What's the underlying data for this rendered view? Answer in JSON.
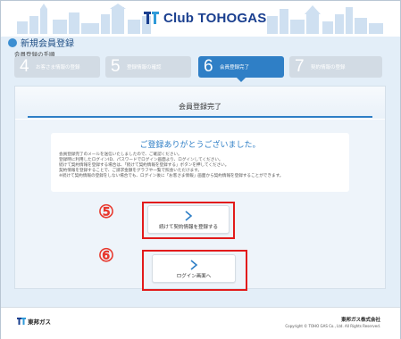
{
  "header": {
    "brand": "Club TOHOGAS"
  },
  "page": {
    "title": "新規会員登録",
    "subtitle": "会員登録の手順"
  },
  "steps": [
    {
      "num": "4",
      "label": "お客さま情報の登録",
      "active": false
    },
    {
      "num": "5",
      "label": "登録情報の確認",
      "active": false
    },
    {
      "num": "6",
      "label": "会員登録完了",
      "active": true
    },
    {
      "num": "7",
      "label": "契約情報の登録",
      "active": false
    }
  ],
  "panel": {
    "title": "会員登録完了",
    "message_title": "ご登録ありがとうございました。",
    "message_lines": [
      "会員登録完了のメールを送信いたしましたので、ご確認ください。",
      "登録時に利用したログインID、パスワードでログイン画面より、ログインしてください。",
      "続けて契約情報を登録する場合は、「続けて契約情報を登録する」ボタンを押してください。",
      "契約情報を登録することで、ご請求金額をグラフや一覧で照会いただけます。",
      "※続けて契約情報の登録をしない場合でも、ログイン後に「お客さま情報」画面から契約情報を登録することができます。"
    ]
  },
  "annotations": {
    "five": "⑤",
    "six": "⑥"
  },
  "buttons": {
    "continue_label": "続けて契約情報を登録する",
    "login_label": "ログイン画面へ"
  },
  "footer": {
    "logo_text": "東邦ガス",
    "company": "東邦ガス株式会社",
    "copyright": "Copyright © TOHO GAS Co., Ltd. All Rights Reserved."
  },
  "colors": {
    "accent": "#2f7fc6",
    "highlight": "#e21b1b",
    "brand": "#1a3f8f"
  }
}
